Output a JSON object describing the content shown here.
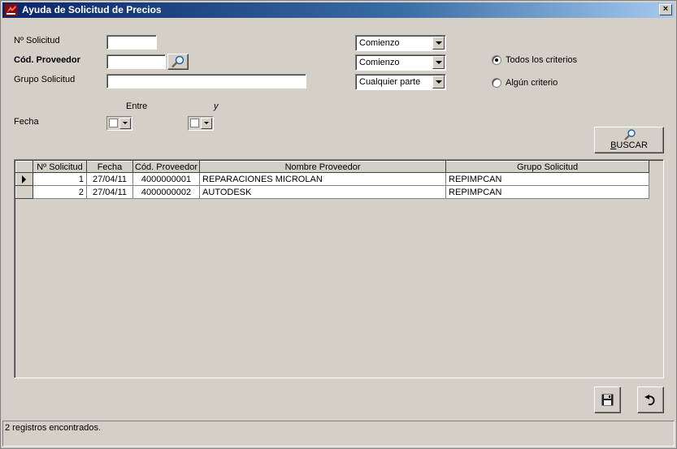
{
  "window": {
    "title": "Ayuda de Solicitud de Precios",
    "close_label": "×"
  },
  "form": {
    "num_solicitud_label": "Nº Solicitud",
    "num_solicitud_value": "",
    "cod_proveedor_label": "Cód. Proveedor",
    "cod_proveedor_value": "",
    "grupo_solicitud_label": "Grupo Solicitud",
    "grupo_solicitud_value": "",
    "combo1": "Comienzo",
    "combo2": "Comienzo",
    "combo3": "Cualquier parte",
    "radio_todos_label": "Todos los criterios",
    "radio_algun_label": "Algún criterio",
    "fecha_label": "Fecha",
    "entre_label": "Entre",
    "y_label": "y",
    "buscar_label": "BUSCAR",
    "buscar_hotkey": "B",
    "buscar_rest": "USCAR"
  },
  "grid": {
    "columns": [
      "Nº Solicitud",
      "Fecha",
      "Cód. Proveedor",
      "Nombre Proveedor",
      "Grupo Solicitud"
    ],
    "rows": [
      {
        "num": "1",
        "fecha": "27/04/11",
        "cod": "4000000001",
        "nombre": "REPARACIONES MICROLAN",
        "grupo": "REPIMPCAN"
      },
      {
        "num": "2",
        "fecha": "27/04/11",
        "cod": "4000000002",
        "nombre": "AUTODESK",
        "grupo": "REPIMPCAN"
      }
    ]
  },
  "status": {
    "text": "2 registros encontrados."
  },
  "colors": {
    "face": "#d4d0c8",
    "title_start": "#0a246a",
    "title_end": "#a6caf0"
  }
}
